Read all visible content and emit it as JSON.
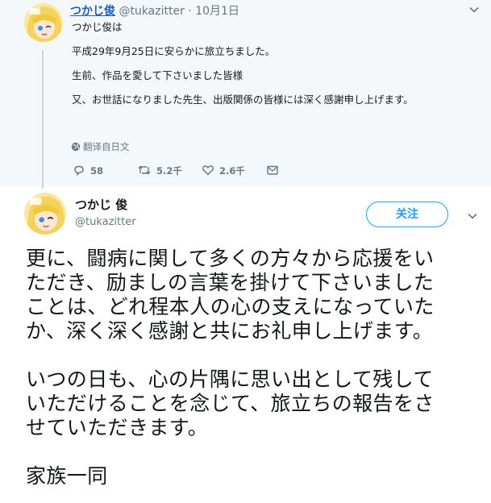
{
  "tweet1": {
    "name": "つかじ俊",
    "handle": "@tukazitter",
    "dot": "·",
    "time": "10月1日",
    "lines": [
      "つかじ俊は",
      "",
      "平成29年9月25日に安らかに旅立ちました。",
      "",
      "生前、作品を愛して下さいました皆様",
      "",
      "又、お世話になりました先生、出版関係の皆様には深く感謝申し上げます。"
    ],
    "translate_label": "翻译自日文",
    "replies": "58",
    "retweets": "5.2千",
    "likes": "2.6千"
  },
  "tweet2": {
    "name": "つかじ 俊",
    "handle": "@tukazitter",
    "follow_label": "关注",
    "lines": [
      "更に、闘病に関して多くの方々から応援をい",
      "ただき、励ましの言葉を掛けて下さいました",
      "ことは、どれ程本人の心の支えになっていた",
      "か、深く深く感謝と共にお礼申し上げます。",
      "",
      "いつの日も、心の片隅に思い出として残して",
      "いただけることを念じて、旅立ちの報告をさ",
      "せていただきます。",
      "",
      "家族一同"
    ]
  },
  "colors": {
    "link_blue": "#1da1f2",
    "name_blue": "#1b5fbf",
    "muted_gray": "#657786",
    "thread_bg": "#f5f8fa"
  },
  "icons": [
    "avatar",
    "chevron-down-icon",
    "globe-icon",
    "reply-icon",
    "retweet-icon",
    "like-icon",
    "dm-icon"
  ]
}
